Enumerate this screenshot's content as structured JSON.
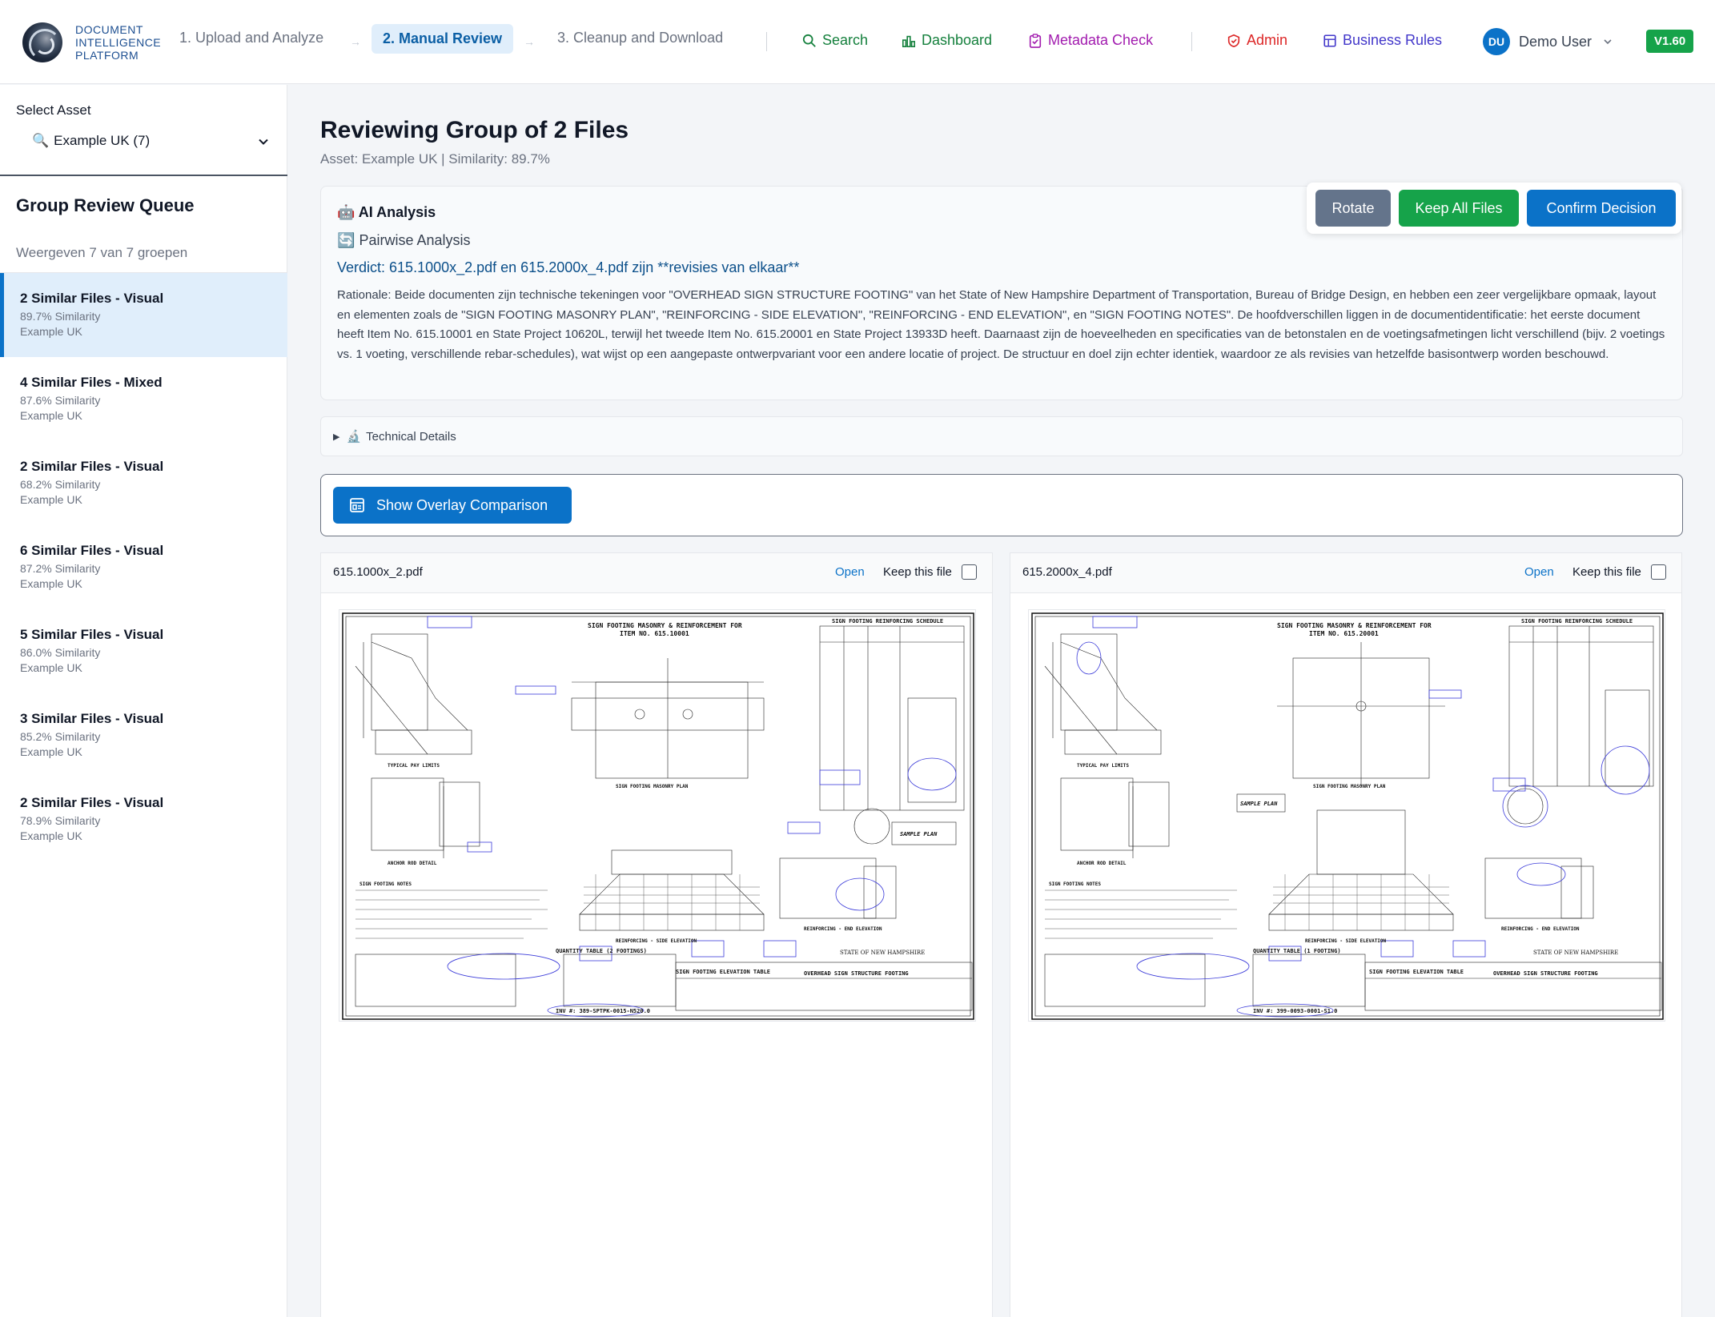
{
  "brand": {
    "line1": "DOCUMENT",
    "line2": "INTELLIGENCE",
    "line3": "PLATFORM"
  },
  "steps": [
    {
      "label": "1. Upload and Analyze"
    },
    {
      "label": "2. Manual Review"
    },
    {
      "label": "3. Cleanup and Download"
    }
  ],
  "nav": {
    "search": "Search",
    "dashboard": "Dashboard",
    "metadata": "Metadata Check",
    "admin": "Admin",
    "rules": "Business Rules"
  },
  "user": {
    "initials": "DU",
    "name": "Demo User"
  },
  "version": "V1.60",
  "sidebar": {
    "select_label": "Select Asset",
    "select_value": "Example UK (7)",
    "queue_title": "Group Review Queue",
    "queue_count": "Weergeven 7 van 7 groepen",
    "items": [
      {
        "title": "2 Similar Files - Visual",
        "similarity": "89.7% Similarity",
        "asset": "Example UK"
      },
      {
        "title": "4 Similar Files - Mixed",
        "similarity": "87.6% Similarity",
        "asset": "Example UK"
      },
      {
        "title": "2 Similar Files - Visual",
        "similarity": "68.2% Similarity",
        "asset": "Example UK"
      },
      {
        "title": "6 Similar Files - Visual",
        "similarity": "87.2% Similarity",
        "asset": "Example UK"
      },
      {
        "title": "5 Similar Files - Visual",
        "similarity": "86.0% Similarity",
        "asset": "Example UK"
      },
      {
        "title": "3 Similar Files - Visual",
        "similarity": "85.2% Similarity",
        "asset": "Example UK"
      },
      {
        "title": "2 Similar Files - Visual",
        "similarity": "78.9% Similarity",
        "asset": "Example UK"
      }
    ]
  },
  "main": {
    "title": "Reviewing Group of 2 Files",
    "subtitle": "Asset: Example UK | Similarity: 89.7%",
    "ai_heading": "AI Analysis",
    "pairwise": "Pairwise Analysis",
    "verdict": "Verdict: 615.1000x_2.pdf en 615.2000x_4.pdf zijn **revisies van elkaar**",
    "rationale": "Rationale: Beide documenten zijn technische tekeningen voor \"OVERHEAD SIGN STRUCTURE FOOTING\" van het State of New Hampshire Department of Transportation, Bureau of Bridge Design, en hebben een zeer vergelijkbare opmaak, layout en elementen zoals de \"SIGN FOOTING MASONRY PLAN\", \"REINFORCING - SIDE ELEVATION\", \"REINFORCING - END ELEVATION\", en \"SIGN FOOTING NOTES\". De hoofdverschillen liggen in de documentidentificatie: het eerste document heeft Item No. 615.10001 en State Project 10620L, terwijl het tweede Item No. 615.20001 en State Project 13933D heeft. Daarnaast zijn de hoeveelheden en specificaties van de betonstalen en de voetingsafmetingen licht verschillend (bijv. 2 voetings vs. 1 voeting, verschillende rebar-schedules), wat wijst op een aangepaste ontwerpvariant voor een andere locatie of project. De structuur en doel zijn echter identiek, waardoor ze als revisies van hetzelfde basisontwerp worden beschouwd.",
    "actions": {
      "rotate": "Rotate",
      "keep_all": "Keep All Files",
      "confirm": "Confirm Decision"
    },
    "technical": "Technical Details",
    "overlay_button": "Show Overlay Comparison"
  },
  "files": [
    {
      "name": "615.1000x_2.pdf",
      "open": "Open",
      "keep": "Keep this file",
      "drawing": {
        "title1": "SIGN FOOTING MASONRY & REINFORCEMENT FOR",
        "title2": "ITEM NO. 615.10001",
        "schedule": "SIGN FOOTING REINFORCING SCHEDULE",
        "pay": "TYPICAL PAY LIMITS",
        "plan": "SIGN FOOTING MASONRY PLAN",
        "sample": "SAMPLE PLAN",
        "anchor": "ANCHOR ROD DETAIL",
        "notes": "SIGN FOOTING NOTES",
        "side": "REINFORCING - SIDE ELEVATION",
        "end": "REINFORCING - END ELEVATION",
        "qty": "QUANTITY TABLE (2 FOOTINGS)",
        "elev": "SIGN FOOTING ELEVATION TABLE",
        "state": "STATE OF NEW HAMPSHIRE",
        "struct": "OVERHEAD SIGN STRUCTURE FOOTING",
        "inv": "INV #: 389-SPTPK-0015-N520.0"
      }
    },
    {
      "name": "615.2000x_4.pdf",
      "open": "Open",
      "keep": "Keep this file",
      "drawing": {
        "title1": "SIGN FOOTING MASONRY & REINFORCEMENT FOR",
        "title2": "ITEM NO. 615.20001",
        "schedule": "SIGN FOOTING REINFORCING SCHEDULE",
        "pay": "TYPICAL PAY LIMITS",
        "plan": "SIGN FOOTING MASONRY PLAN",
        "sample": "SAMPLE PLAN",
        "anchor": "ANCHOR ROD DETAIL",
        "notes": "SIGN FOOTING NOTES",
        "side": "REINFORCING - SIDE ELEVATION",
        "end": "REINFORCING - END ELEVATION",
        "qty": "QUANTITY TABLE (1 FOOTING)",
        "elev": "SIGN FOOTING ELEVATION TABLE",
        "state": "STATE OF NEW HAMPSHIRE",
        "struct": "OVERHEAD SIGN STRUCTURE FOOTING",
        "inv": "INV #: 399-0093-0001-S1.0"
      }
    }
  ]
}
